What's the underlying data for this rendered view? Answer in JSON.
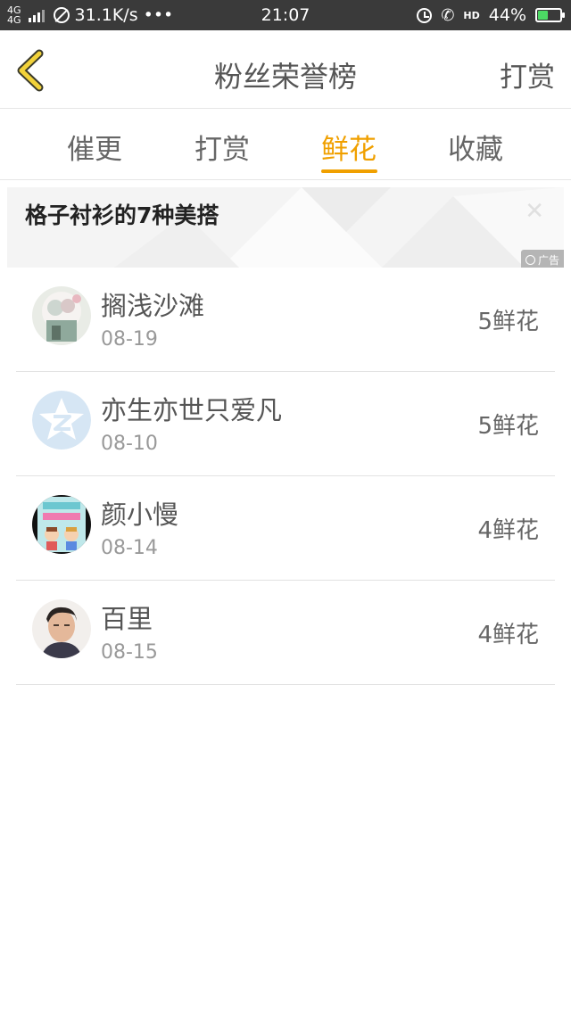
{
  "status_bar": {
    "network_type": "4G",
    "network_type_2": "4G",
    "speed": "31.1K/s",
    "more": "•••",
    "time": "21:07",
    "hd": "HD",
    "battery": "44%",
    "battery_level": 0.44,
    "icons": [
      "signal-icon",
      "no-sim-icon",
      "alarm-icon",
      "call-icon",
      "battery-charging-icon"
    ]
  },
  "header": {
    "back_icon": "chevron-left-icon",
    "title": "粉丝荣誉榜",
    "action_label": "打赏",
    "accent_color": "#f0a000"
  },
  "tabs": [
    {
      "label": "催更",
      "active": false
    },
    {
      "label": "打赏",
      "active": false
    },
    {
      "label": "鲜花",
      "active": true
    },
    {
      "label": "收藏",
      "active": false
    }
  ],
  "ad": {
    "title": "格子衬衫的7种美搭",
    "close_icon": "close-icon",
    "badge_label": "广告"
  },
  "fans": [
    {
      "name": "搁浅沙滩",
      "date": "08-19",
      "count": "5鲜花",
      "avatar": "anime-couple-avatar"
    },
    {
      "name": "亦生亦世只爱凡",
      "date": "08-10",
      "count": "5鲜花",
      "avatar": "qzone-logo-avatar"
    },
    {
      "name": "颜小慢",
      "date": "08-14",
      "count": "4鲜花",
      "avatar": "cartoon-book-avatar"
    },
    {
      "name": "百里",
      "date": "08-15",
      "count": "4鲜花",
      "avatar": "photo-avatar"
    }
  ]
}
